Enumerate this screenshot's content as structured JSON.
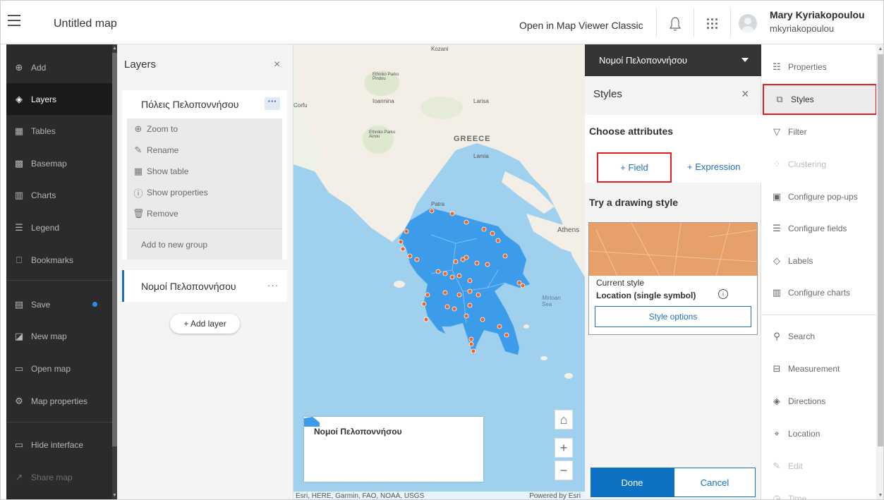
{
  "header": {
    "title": "Untitled map",
    "classic_link": "Open in Map Viewer Classic",
    "user_name": "Mary Kyriakopoulou",
    "user_id": "mkyriakopoulou"
  },
  "leftnav": {
    "items": [
      {
        "label": "Add",
        "icon": "plus-circle-icon"
      },
      {
        "label": "Layers",
        "icon": "layers-icon"
      },
      {
        "label": "Tables",
        "icon": "table-icon"
      },
      {
        "label": "Basemap",
        "icon": "basemap-icon"
      },
      {
        "label": "Charts",
        "icon": "chart-icon"
      },
      {
        "label": "Legend",
        "icon": "legend-icon"
      },
      {
        "label": "Bookmarks",
        "icon": "bookmark-icon"
      },
      {
        "label": "Save",
        "icon": "save-icon"
      },
      {
        "label": "New map",
        "icon": "new-map-icon"
      },
      {
        "label": "Open map",
        "icon": "folder-icon"
      },
      {
        "label": "Map properties",
        "icon": "gear-icon"
      },
      {
        "label": "Hide interface",
        "icon": "monitor-icon"
      },
      {
        "label": "Share map",
        "icon": "share-icon"
      }
    ]
  },
  "layers_panel": {
    "title": "Layers",
    "layer1": {
      "name": "Πόλεις Πελοποννήσου",
      "menu": [
        {
          "label": "Zoom to",
          "icon": "zoom-icon"
        },
        {
          "label": "Rename",
          "icon": "pencil-icon"
        },
        {
          "label": "Show table",
          "icon": "table-icon"
        },
        {
          "label": "Show properties",
          "icon": "info-icon"
        },
        {
          "label": "Remove",
          "icon": "trash-icon"
        }
      ],
      "group": "Add to new group"
    },
    "layer2": {
      "name": "Νομοί Πελοποννήσου"
    },
    "add_layer": "+ Add layer"
  },
  "map": {
    "labels": [
      "Kozani",
      "Ethniko Parko Pindou",
      "Ioannina",
      "Larisa",
      "Corfu",
      "GREECE",
      "Ethniko Parko Ainou",
      "Lamia",
      "Patra",
      "Athens",
      "Mirtoan Sea"
    ],
    "legend_title": "Νομοί Πελοποννήσου",
    "attribution": "Esri, HERE, Garmin, FAO, NOAA, USGS",
    "powered_by": "Powered by Esri",
    "colors": {
      "water": "#9fd1ee",
      "land": "#f4efe6",
      "polygon": "#3d9cea",
      "point": "#f26322"
    }
  },
  "styles_panel": {
    "layer_dropdown": "Νομοί Πελοποννήσου",
    "title": "Styles",
    "choose_attributes": "Choose attributes",
    "field_button": "+  Field",
    "expression_button": "+  Expression",
    "try_drawing": "Try a drawing style",
    "current_style": "Current style",
    "location_style": "Location (single symbol)",
    "style_options": "Style options",
    "done": "Done",
    "cancel": "Cancel"
  },
  "tools": {
    "items": [
      {
        "label": "Properties",
        "icon": "sliders-icon"
      },
      {
        "label": "Styles",
        "icon": "styles-icon"
      },
      {
        "label": "Filter",
        "icon": "filter-icon"
      },
      {
        "label": "Clustering",
        "icon": "clustering-icon"
      },
      {
        "label": "Configure pop-ups",
        "icon": "popup-icon"
      },
      {
        "label": "Configure fields",
        "icon": "fields-icon"
      },
      {
        "label": "Labels",
        "icon": "label-icon"
      },
      {
        "label": "Configure charts",
        "icon": "configure-chart-icon"
      },
      {
        "label": "Search",
        "icon": "search-icon"
      },
      {
        "label": "Measurement",
        "icon": "ruler-icon"
      },
      {
        "label": "Directions",
        "icon": "directions-icon"
      },
      {
        "label": "Location",
        "icon": "location-icon"
      },
      {
        "label": "Edit",
        "icon": "edit-icon"
      },
      {
        "label": "Time",
        "icon": "clock-icon"
      }
    ]
  }
}
